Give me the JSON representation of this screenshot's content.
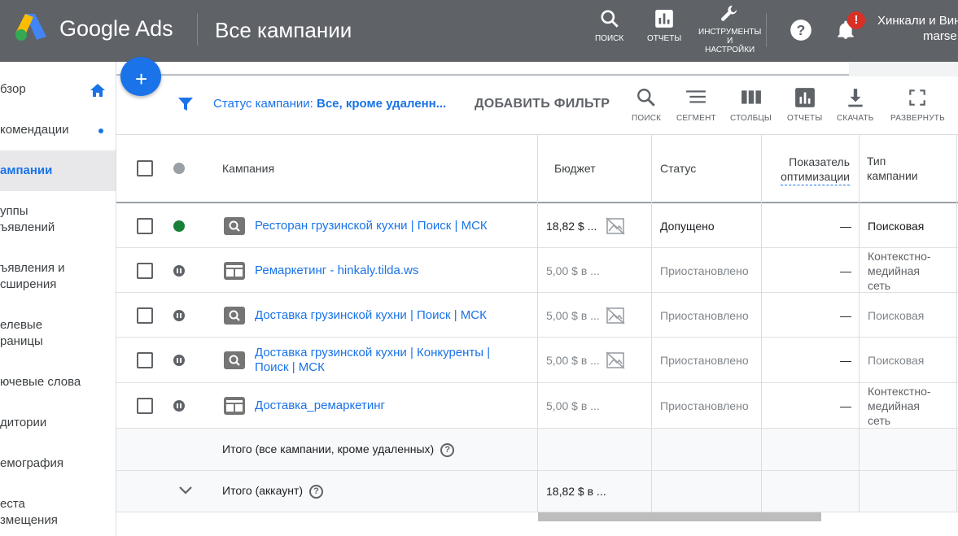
{
  "header": {
    "brand": "Google Ads",
    "page_title": "Все кампании",
    "tools": [
      {
        "label": "ПОИСК",
        "icon": "search-icon"
      },
      {
        "label": "ОТЧЕТЫ",
        "icon": "reports-icon"
      },
      {
        "label_lines": [
          "ИНСТРУМЕНТЫ",
          "И",
          "НАСТРОЙКИ"
        ],
        "icon": "wrench-icon"
      }
    ],
    "help_icon": "help-icon",
    "notifications_icon": "bell-icon",
    "notification_badge": "!",
    "account_name": "Хинкали и Вин",
    "account_email": "marse"
  },
  "sidebar": {
    "items": [
      {
        "label": "бзор",
        "icon": "home-icon"
      },
      {
        "label": "комендации",
        "icon": "dot-indicator"
      },
      {
        "label": "ампании",
        "active": true
      },
      {
        "label": "уппы",
        "label2": "ъявлений"
      },
      {
        "label": "ъявления и",
        "label2": "сширения"
      },
      {
        "label": "елевые",
        "label2": "раницы"
      },
      {
        "label": "ючевые слова"
      },
      {
        "label": "дитории"
      },
      {
        "label": "емография"
      },
      {
        "label": "еста",
        "label2": "змещения"
      }
    ]
  },
  "fab": {
    "label": "+"
  },
  "filter": {
    "prefix": "Статус кампании: ",
    "value": "Все, кроме удаленн...",
    "add_filter": "ДОБАВИТЬ ФИЛЬТР"
  },
  "toolbar": {
    "search": "ПОИСК",
    "segment": "СЕГМЕНТ",
    "columns": "СТОЛБЦЫ",
    "reports": "ОТЧЕТЫ",
    "download": "СКАЧАТЬ",
    "expand": "РАЗВЕРНУТЬ"
  },
  "table": {
    "headers": {
      "campaign": "Кампания",
      "budget": "Бюджет",
      "status": "Статус",
      "optimization_1": "Показатель",
      "optimization_2": "оптимизации",
      "type_1": "Тип",
      "type_2": "кампании"
    },
    "rows": [
      {
        "name": "Ресторан грузинской кухни | Поиск | МСК",
        "name2": "",
        "budget": "18,82 $ ...",
        "status": "Допущено",
        "optimization": "—",
        "type": "Поисковая",
        "type2": "",
        "type3": "",
        "state": "enabled",
        "campaign_icon": "search-campaign-icon"
      },
      {
        "name": "Ремаркетинг - hinkaly.tilda.ws",
        "name2": "",
        "budget": "5,00 $ в ...",
        "status": "Приостановлено",
        "optimization": "—",
        "type": "Контекстно-",
        "type2": "медийная",
        "type3": "сеть",
        "state": "paused",
        "campaign_icon": "display-campaign-icon"
      },
      {
        "name": "Доставка грузинской кухни | Поиск | МСК",
        "name2": "",
        "budget": "5,00 $ в ...",
        "status": "Приостановлено",
        "optimization": "—",
        "type": "Поисковая",
        "type2": "",
        "type3": "",
        "state": "paused",
        "campaign_icon": "search-campaign-icon"
      },
      {
        "name": "Доставка грузинской кухни | Конкуренты |",
        "name2": "Поиск | МСК",
        "budget": "5,00 $ в ...",
        "status": "Приостановлено",
        "optimization": "—",
        "type": "Поисковая",
        "type2": "",
        "type3": "",
        "state": "paused",
        "campaign_icon": "search-campaign-icon"
      },
      {
        "name": "Доставка_ремаркетинг",
        "name2": "",
        "budget": "5,00 $ в ...",
        "status": "Приостановлено",
        "optimization": "—",
        "type": "Контекстно-",
        "type2": "медийная",
        "type3": "сеть",
        "state": "paused",
        "campaign_icon": "display-campaign-icon"
      }
    ],
    "totals": [
      {
        "label": "Итого (все кампании, кроме удаленных)",
        "budget": ""
      },
      {
        "label": "Итого (аккаунт)",
        "budget": "18,82 $ в ..."
      }
    ]
  },
  "colors": {
    "header_bg": "#5f6368",
    "accent": "#1a73e8",
    "enabled_green": "#188038",
    "badge_red": "#d93025"
  }
}
